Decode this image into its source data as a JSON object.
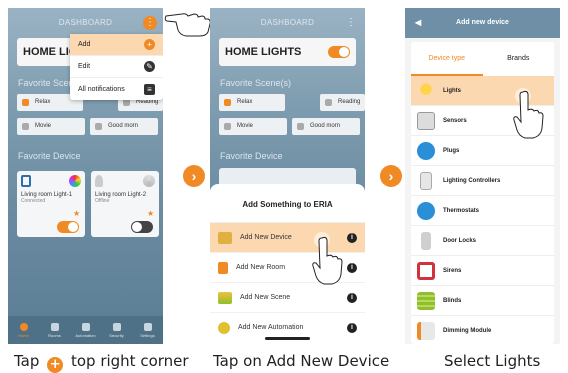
{
  "colors": {
    "accent": "#f08a24",
    "highlight": "#fcd8b0",
    "blue_icon": "#2a8fd6",
    "red_icon": "#d0333b",
    "green_icon": "#8fbf2a"
  },
  "screen1": {
    "title": "DASHBOARD",
    "home_card_title": "HOME LIGHTS",
    "section_scenes": "Favorite Scene(s)",
    "scenes": [
      {
        "label": "Relax",
        "icon": "relax-icon"
      },
      {
        "label": "Reading",
        "icon": "reading-icon"
      },
      {
        "label": "Movie",
        "icon": "movie-icon"
      },
      {
        "label": "Good morn",
        "icon": "sunrise-icon"
      }
    ],
    "section_devices": "Favorite Device",
    "devices": [
      {
        "name": "Living room Light-1",
        "status": "Connected",
        "toggle_on": true
      },
      {
        "name": "Living room Light-2",
        "status": "Offline",
        "toggle_on": false
      }
    ],
    "menu": [
      {
        "label": "Add",
        "icon": "plus-icon"
      },
      {
        "label": "Edit",
        "icon": "pencil-icon"
      },
      {
        "label": "All notifications",
        "icon": "message-icon"
      }
    ],
    "tabs": [
      {
        "label": "Home",
        "icon": "home-icon"
      },
      {
        "label": "Rooms",
        "icon": "rooms-icon"
      },
      {
        "label": "Automation",
        "icon": "automation-icon"
      },
      {
        "label": "Security",
        "icon": "shield-icon"
      },
      {
        "label": "Settings",
        "icon": "gear-icon"
      }
    ]
  },
  "screen2": {
    "title": "DASHBOARD",
    "home_card_title": "HOME LIGHTS",
    "section_scenes": "Favorite Scene(s)",
    "scenes": [
      "Relax",
      "Reading",
      "Movie",
      "Good morn"
    ],
    "section_devices": "Favorite Device",
    "sheet_title": "Add Something to ERIA",
    "sheet_items": [
      {
        "label": "Add New Device",
        "icon": "device-icon"
      },
      {
        "label": "Add New Room",
        "icon": "door-icon"
      },
      {
        "label": "Add New Scene",
        "icon": "layers-icon"
      },
      {
        "label": "Add New Automation",
        "icon": "clock-icon"
      }
    ]
  },
  "screen3": {
    "title": "Add new device",
    "tabs": [
      "Device type",
      "Brands"
    ],
    "items": [
      {
        "label": "Lights",
        "icon": "bulb-icon"
      },
      {
        "label": "Sensors",
        "icon": "sensor-icon"
      },
      {
        "label": "Plugs",
        "icon": "plug-icon"
      },
      {
        "label": "Lighting Controllers",
        "icon": "switch-icon"
      },
      {
        "label": "Thermostats",
        "icon": "thermometer-icon"
      },
      {
        "label": "Door Locks",
        "icon": "lock-icon"
      },
      {
        "label": "Sirens",
        "icon": "siren-icon"
      },
      {
        "label": "Blinds",
        "icon": "blinds-icon"
      },
      {
        "label": "Dimming Module",
        "icon": "dimmer-icon"
      }
    ]
  },
  "captions": {
    "step1_before": "Tap",
    "step1_after": "top right corner",
    "step2": "Tap on Add New Device",
    "step3": "Select Lights"
  }
}
